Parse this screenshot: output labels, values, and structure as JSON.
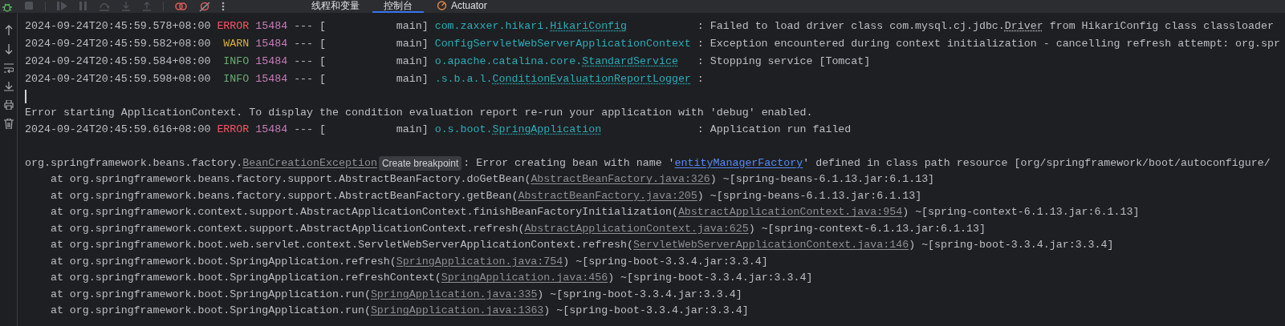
{
  "tabs": [
    {
      "label": "线程和变量",
      "selected": false,
      "icon": false
    },
    {
      "label": "控制台",
      "selected": true,
      "icon": false
    },
    {
      "label": "Actuator",
      "selected": false,
      "icon": true
    }
  ],
  "lines": [
    {
      "kind": "log",
      "timestamp": "2024-09-24T20:45:59.578+08:00",
      "level": "ERROR",
      "pid": "15484",
      "separator": "--- [",
      "thread": "main]",
      "logger": [
        {
          "kind": "logger",
          "text": "com.zaxxer.hikari."
        },
        {
          "kind": "logger-link",
          "text": "HikariConfig"
        }
      ],
      "message": [
        {
          "kind": "plain",
          "text": ": Failed to load driver class com.mysql.cj.jdbc."
        },
        {
          "kind": "ref",
          "text": "Driver"
        },
        {
          "kind": "plain",
          "text": " from HikariConfig class classloader"
        }
      ]
    },
    {
      "kind": "log",
      "timestamp": "2024-09-24T20:45:59.582+08:00",
      "level": "WARN",
      "pid": "15484",
      "separator": "--- [",
      "thread": "main]",
      "logger": [
        {
          "kind": "logger",
          "text": "ConfigServletWebServerApplicationContext"
        }
      ],
      "message": [
        {
          "kind": "plain",
          "text": ": Exception encountered during context initialization - cancelling refresh attempt: org.spr"
        }
      ]
    },
    {
      "kind": "log",
      "timestamp": "2024-09-24T20:45:59.584+08:00",
      "level": "INFO",
      "pid": "15484",
      "separator": "--- [",
      "thread": "main]",
      "logger": [
        {
          "kind": "logger",
          "text": "o.apache.catalina.core."
        },
        {
          "kind": "logger-link",
          "text": "StandardService"
        }
      ],
      "message": [
        {
          "kind": "plain",
          "text": ": Stopping service [Tomcat]"
        }
      ]
    },
    {
      "kind": "log",
      "timestamp": "2024-09-24T20:45:59.598+08:00",
      "level": "INFO",
      "pid": "15484",
      "separator": "--- [",
      "thread": "main]",
      "logger": [
        {
          "kind": "logger",
          "text": ".s.b.a.l."
        },
        {
          "kind": "logger-link",
          "text": "ConditionEvaluationReportLogger"
        }
      ],
      "message": [
        {
          "kind": "plain",
          "text": ":"
        }
      ]
    },
    {
      "kind": "cursor"
    },
    {
      "kind": "text",
      "parts": [
        {
          "kind": "plain",
          "text": "Error starting ApplicationContext. To display the condition evaluation report re-run your application with 'debug' enabled."
        }
      ]
    },
    {
      "kind": "log",
      "timestamp": "2024-09-24T20:45:59.616+08:00",
      "level": "ERROR",
      "pid": "15484",
      "separator": "--- [",
      "thread": "main]",
      "logger": [
        {
          "kind": "logger",
          "text": "o.s.boot."
        },
        {
          "kind": "logger-link",
          "text": "SpringApplication"
        }
      ],
      "message": [
        {
          "kind": "plain",
          "text": ": Application run failed"
        }
      ]
    },
    {
      "kind": "blank"
    },
    {
      "kind": "text",
      "parts": [
        {
          "kind": "plain",
          "text": "org.springframework.beans.factory."
        },
        {
          "kind": "source-link",
          "text": "BeanCreationException"
        },
        {
          "kind": "badge",
          "text": "Create breakpoint"
        },
        {
          "kind": "plain",
          "text": ": Error creating bean with name '"
        },
        {
          "kind": "link",
          "text": "entityManagerFactory"
        },
        {
          "kind": "plain",
          "text": "' defined in class path resource [org/springframework/boot/autoconfigure/"
        }
      ]
    },
    {
      "kind": "stack",
      "parts": [
        {
          "kind": "plain",
          "text": "at org.springframework.beans.factory.support.AbstractBeanFactory.doGetBean("
        },
        {
          "kind": "source-link",
          "text": "AbstractBeanFactory.java:326"
        },
        {
          "kind": "plain",
          "text": ") ~[spring-beans-6.1.13.jar:6.1.13]"
        }
      ]
    },
    {
      "kind": "stack",
      "parts": [
        {
          "kind": "plain",
          "text": "at org.springframework.beans.factory.support.AbstractBeanFactory.getBean("
        },
        {
          "kind": "source-link",
          "text": "AbstractBeanFactory.java:205"
        },
        {
          "kind": "plain",
          "text": ") ~[spring-beans-6.1.13.jar:6.1.13]"
        }
      ]
    },
    {
      "kind": "stack",
      "parts": [
        {
          "kind": "plain",
          "text": "at org.springframework.context.support.AbstractApplicationContext.finishBeanFactoryInitialization("
        },
        {
          "kind": "source-link",
          "text": "AbstractApplicationContext.java:954"
        },
        {
          "kind": "plain",
          "text": ") ~[spring-context-6.1.13.jar:6.1.13]"
        }
      ]
    },
    {
      "kind": "stack",
      "parts": [
        {
          "kind": "plain",
          "text": "at org.springframework.context.support.AbstractApplicationContext.refresh("
        },
        {
          "kind": "source-link",
          "text": "AbstractApplicationContext.java:625"
        },
        {
          "kind": "plain",
          "text": ") ~[spring-context-6.1.13.jar:6.1.13]"
        }
      ]
    },
    {
      "kind": "stack",
      "parts": [
        {
          "kind": "plain",
          "text": "at org.springframework.boot.web.servlet.context.ServletWebServerApplicationContext.refresh("
        },
        {
          "kind": "source-link",
          "text": "ServletWebServerApplicationContext.java:146"
        },
        {
          "kind": "plain",
          "text": ") ~[spring-boot-3.3.4.jar:3.3.4]"
        }
      ]
    },
    {
      "kind": "stack",
      "parts": [
        {
          "kind": "plain",
          "text": "at org.springframework.boot.SpringApplication.refresh("
        },
        {
          "kind": "source-link",
          "text": "SpringApplication.java:754"
        },
        {
          "kind": "plain",
          "text": ") ~[spring-boot-3.3.4.jar:3.3.4]"
        }
      ]
    },
    {
      "kind": "stack",
      "parts": [
        {
          "kind": "plain",
          "text": "at org.springframework.boot.SpringApplication.refreshContext("
        },
        {
          "kind": "source-link",
          "text": "SpringApplication.java:456"
        },
        {
          "kind": "plain",
          "text": ") ~[spring-boot-3.3.4.jar:3.3.4]"
        }
      ]
    },
    {
      "kind": "stack",
      "parts": [
        {
          "kind": "plain",
          "text": "at org.springframework.boot.SpringApplication.run("
        },
        {
          "kind": "source-link",
          "text": "SpringApplication.java:335"
        },
        {
          "kind": "plain",
          "text": ") ~[spring-boot-3.3.4.jar:3.3.4]"
        }
      ]
    },
    {
      "kind": "stack",
      "parts": [
        {
          "kind": "plain",
          "text": "at org.springframework.boot.SpringApplication.run("
        },
        {
          "kind": "source-link",
          "text": "SpringApplication.java:1363"
        },
        {
          "kind": "plain",
          "text": ") ~[spring-boot-3.3.4.jar:3.3.4]"
        }
      ]
    }
  ]
}
